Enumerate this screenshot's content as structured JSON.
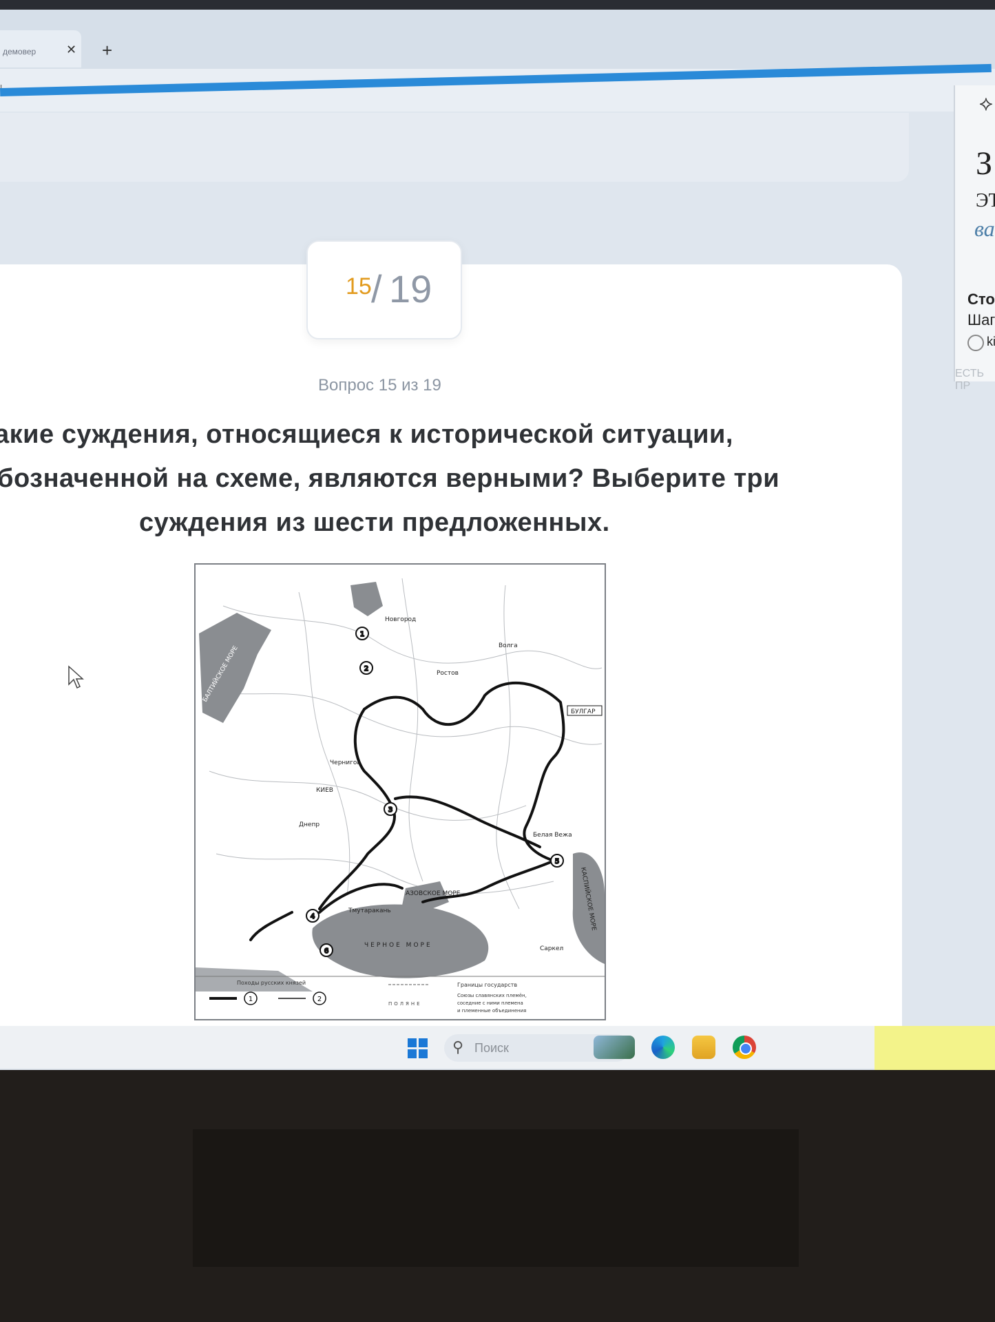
{
  "browser": {
    "tab_title": "демовер",
    "tab_close": "✕",
    "new_tab": "+",
    "address_fragment": "l"
  },
  "quiz": {
    "counter_current": "15",
    "counter_slash": "/",
    "counter_total": "19",
    "question_label": "Вопрос 15 из 19",
    "question_line1": "акие суждения, относящиеся к исторической ситуации,",
    "question_line2": "бозначенной на схеме, являются верными? Выберите три",
    "question_line3": "суждения из шести предложенных."
  },
  "map": {
    "labels": {
      "bulgar": "БУЛГАР",
      "kiev": "КИЕВ",
      "black_sea": "ЧЕРНОЕ МОРЕ",
      "caspian": "КАСПИЙСКОЕ МОРЕ",
      "baltic": "БАЛТИЙСКОЕ МОРЕ",
      "rostov": "Ростов",
      "tmutarakan": "Тмутаракань",
      "azov": "АЗОВСКОЕ МОРЕ",
      "sarkel": "Саркел",
      "belaya_vezha": "Белая Вежа",
      "novgorod": "Новгород",
      "volga": "Волга",
      "chernigov": "Чернигов",
      "dnepr": "Днепр"
    },
    "markers": [
      "1",
      "2",
      "3",
      "4",
      "5",
      "6"
    ],
    "legend": {
      "campaigns_title": "Походы русских князей",
      "marker_1": "1",
      "marker_2": "2",
      "borders": "Границы государств",
      "unions_line1": "Союзы славянских племён,",
      "unions_line2": "соседние с ними племена",
      "unions_line3": "и племенные объединения",
      "tribe_sample": "ПОЛЯНЕ"
    }
  },
  "sidebar": {
    "glyph": "⟡",
    "big": "З",
    "et": "ЭТ",
    "va": "ва",
    "sto": "Сто",
    "sha": "Шаг",
    "ki": "ki",
    "est": "ЕСТЬ ПР"
  },
  "taskbar": {
    "search_icon": "⚲",
    "search_placeholder": "Поиск"
  },
  "colors": {
    "accent_progress": "#2a8ad8",
    "counter_current": "#e29b1f",
    "windows_blue": "#1a78d6"
  }
}
